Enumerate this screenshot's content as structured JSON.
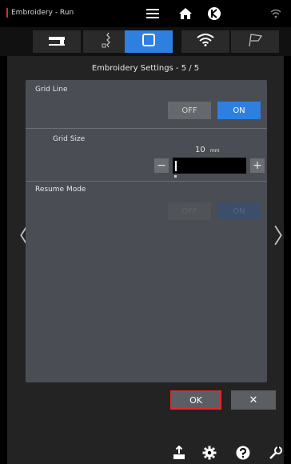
{
  "header": {
    "mode_title": "Embroidery - Run"
  },
  "tabs": [
    {
      "name": "sewing-machine-icon",
      "active": false
    },
    {
      "name": "thread-icon",
      "active": false
    },
    {
      "name": "embroidery-frame-icon",
      "active": true
    },
    {
      "name": "wifi-icon",
      "active": false
    },
    {
      "name": "flag-icon",
      "active": false
    }
  ],
  "settings": {
    "title": "Embroidery Settings - 5 / 5",
    "grid_line": {
      "label": "Grid Line",
      "off_label": "OFF",
      "on_label": "ON",
      "selected": "ON"
    },
    "grid_size": {
      "label": "Grid Size",
      "value": "10",
      "unit": "mm",
      "minus_label": "−",
      "plus_label": "+"
    },
    "resume_mode": {
      "label": "Resume Mode",
      "off_label": "OFF",
      "on_label": "ON",
      "enabled": false
    }
  },
  "footer": {
    "ok_label": "OK",
    "close_label": "✕"
  },
  "colors": {
    "accent": "#2f7fe0",
    "panel": "#4a4d53",
    "highlight": "#e0282c"
  }
}
